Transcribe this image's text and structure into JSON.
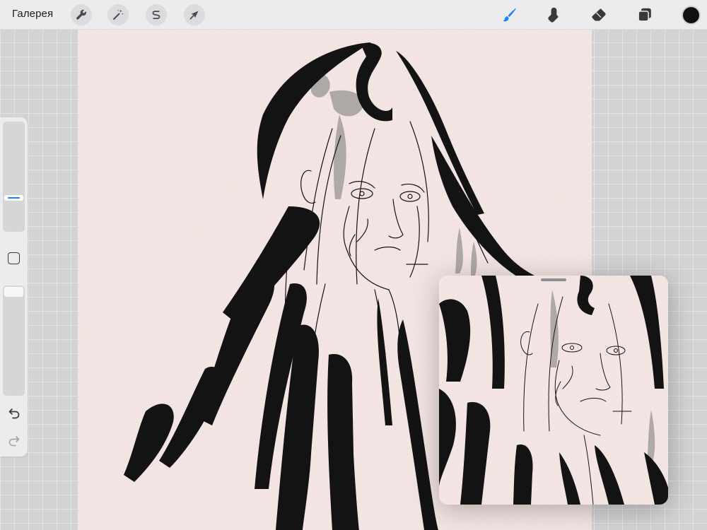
{
  "toolbar": {
    "gallery_label": "Галерея",
    "left_tools": [
      {
        "name": "actions",
        "icon": "wrench-icon"
      },
      {
        "name": "adjustments",
        "icon": "magic-wand-icon"
      },
      {
        "name": "selection",
        "icon": "selection-s-icon"
      },
      {
        "name": "transform",
        "icon": "arrow-cursor-icon"
      }
    ],
    "right_tools": [
      {
        "name": "brush",
        "icon": "brush-icon",
        "active": true
      },
      {
        "name": "smudge",
        "icon": "smudge-icon",
        "active": false
      },
      {
        "name": "eraser",
        "icon": "eraser-icon",
        "active": false
      },
      {
        "name": "layers",
        "icon": "layers-icon",
        "active": false
      }
    ],
    "current_color": "#111111"
  },
  "sidebar": {
    "brush_size_level": 0.3,
    "opacity_level": 1.0,
    "icons": [
      "modify-square-icon",
      "undo-icon",
      "redo-icon"
    ]
  },
  "colors": {
    "accent": "#1a82f7",
    "canvas_bg": "#fdeeec",
    "ink": "#141414",
    "wash": "#a9a5a4"
  }
}
